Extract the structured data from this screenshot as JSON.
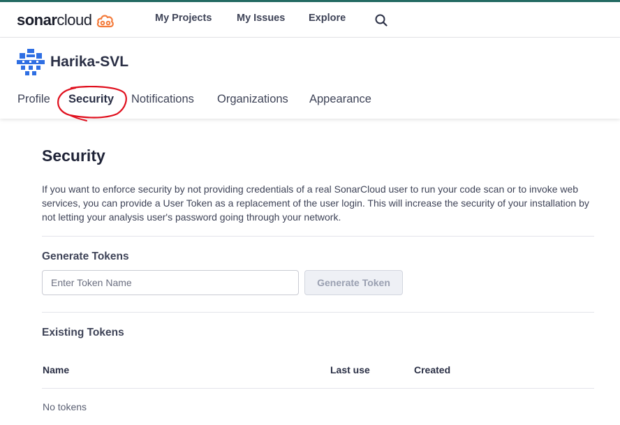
{
  "topnav": {
    "logo_sonar": "sonar",
    "logo_cloud": "cloud",
    "links": [
      "My Projects",
      "My Issues",
      "Explore"
    ],
    "search_icon": "search-icon"
  },
  "profile": {
    "user_name": "Harika-SVL",
    "tabs": [
      "Profile",
      "Security",
      "Notifications",
      "Organizations",
      "Appearance"
    ],
    "active_tab": "Security"
  },
  "security": {
    "title": "Security",
    "description": "If you want to enforce security by not providing credentials of a real SonarCloud user to run your code scan or to invoke web services, you can provide a User Token as a replacement of the user login. This will increase the security of your installation by not letting your analysis user's password going through your network.",
    "generate_title": "Generate Tokens",
    "token_placeholder": "Enter Token Name",
    "token_value": "",
    "generate_button": "Generate Token",
    "existing_title": "Existing Tokens",
    "columns": [
      "Name",
      "Last use",
      "Created"
    ],
    "empty_text": "No tokens"
  },
  "colors": {
    "top_border": "#236a62",
    "logo_orange": "#f47c3c",
    "avatar_blue": "#2f6fe3",
    "annotation_red": "#e0101e"
  }
}
